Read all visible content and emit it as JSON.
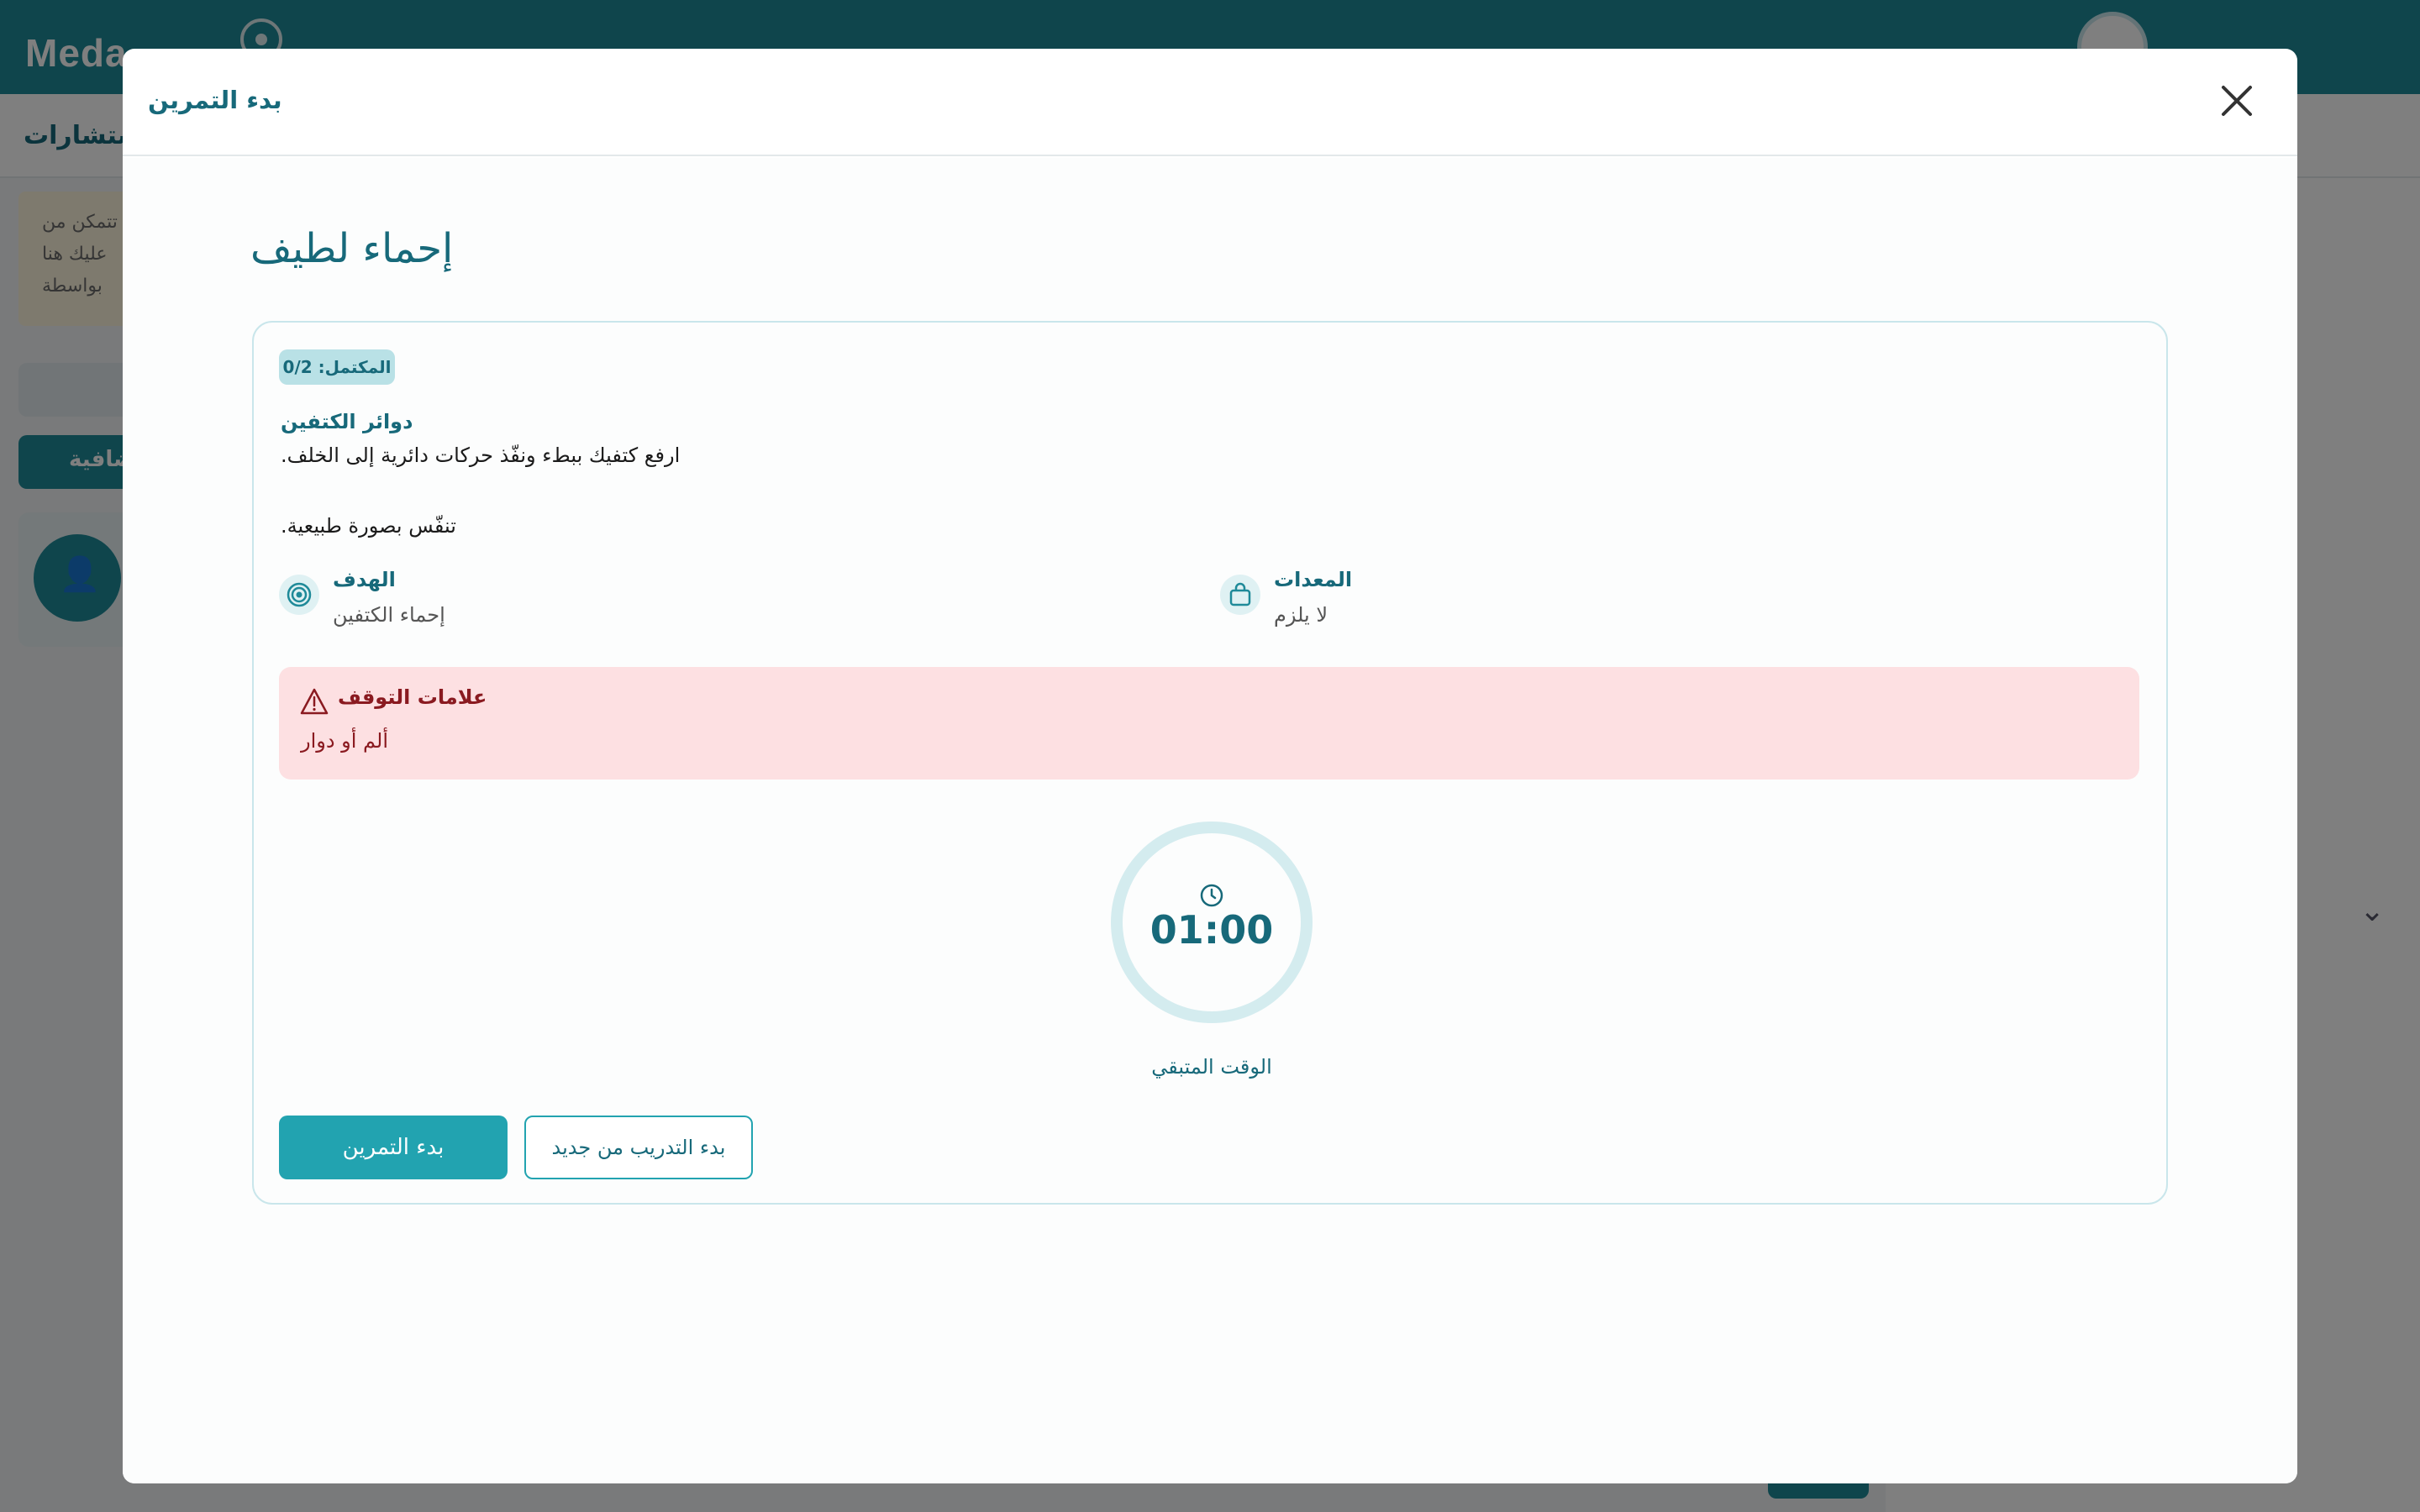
{
  "background_app": {
    "logo_text": "Meda",
    "subnav_label": "استشارات",
    "notice_lines": [
      "حتى تتمكن من",
      "عليك هنا",
      "بواسطة"
    ],
    "panel_button_label": "إضافية"
  },
  "modal": {
    "title": "بدء التمرين",
    "close_icon": "close-icon"
  },
  "exercise": {
    "name": "إحماء لطيف",
    "progress_badge": "المكتمل: 0/2",
    "step_title": "دوائر الكتفين",
    "step_instruction": "ارفع كتفيك ببطء ونفّذ حركات دائرية إلى الخلف.",
    "step_breath": "تنفّس بصورة طبيعية.",
    "goal": {
      "label": "الهدف",
      "value": "إحماء الكتفين",
      "icon": "target-icon"
    },
    "equipment": {
      "label": "المعدات",
      "value": "لا يلزم",
      "icon": "shopping-bag-icon"
    },
    "stop_signs": {
      "title": "علامات التوقف",
      "text": "ألم أو دوار",
      "icon": "warning-triangle-icon"
    },
    "timer": {
      "value": "01:00",
      "label": "الوقت المتبقي",
      "icon": "clock-icon"
    },
    "buttons": {
      "start": "بدء التمرين",
      "restart": "بدء التدريب من جديد"
    }
  },
  "colors": {
    "primary": "#1f8a99",
    "accent": "#22a3b0",
    "text_primary": "#17697a",
    "danger_bg": "#fde0e2",
    "danger_text": "#8a1a20"
  }
}
